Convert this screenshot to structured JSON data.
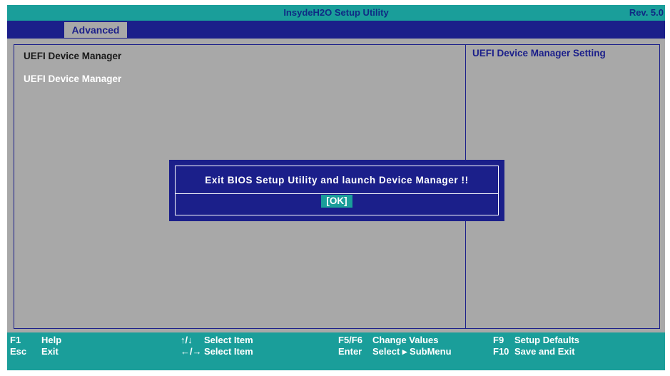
{
  "titlebar": {
    "title": "InsydeH2O Setup Utility",
    "rev": "Rev. 5.0"
  },
  "menubar": {
    "tabs": [
      {
        "label": "Advanced",
        "selected": true
      }
    ]
  },
  "main": {
    "heading": "UEFI Device Manager",
    "items": [
      {
        "label": "UEFI Device Manager",
        "selected": true
      }
    ]
  },
  "help": {
    "title": "UEFI Device Manager Setting"
  },
  "dialog": {
    "message": "Exit BIOS Setup Utility and launch Device Manager !!",
    "ok_label": "[OK]"
  },
  "footer": {
    "keys": [
      {
        "key": "F1",
        "desc": "Help"
      },
      {
        "key": "Esc",
        "desc": "Exit"
      },
      {
        "key": "↑/↓",
        "desc": "Select Item"
      },
      {
        "key": "←/→",
        "desc": "Select Item"
      },
      {
        "key": "F5/F6",
        "desc": "Change Values"
      },
      {
        "key": "Enter",
        "desc": "Select ▸ SubMenu"
      },
      {
        "key": "F9",
        "desc": "Setup Defaults"
      },
      {
        "key": "F10",
        "desc": "Save and Exit"
      }
    ]
  },
  "colors": {
    "teal": "#1a9e9a",
    "navy": "#1b1f8a",
    "gray": "#a8a8a8",
    "white": "#ffffff"
  }
}
